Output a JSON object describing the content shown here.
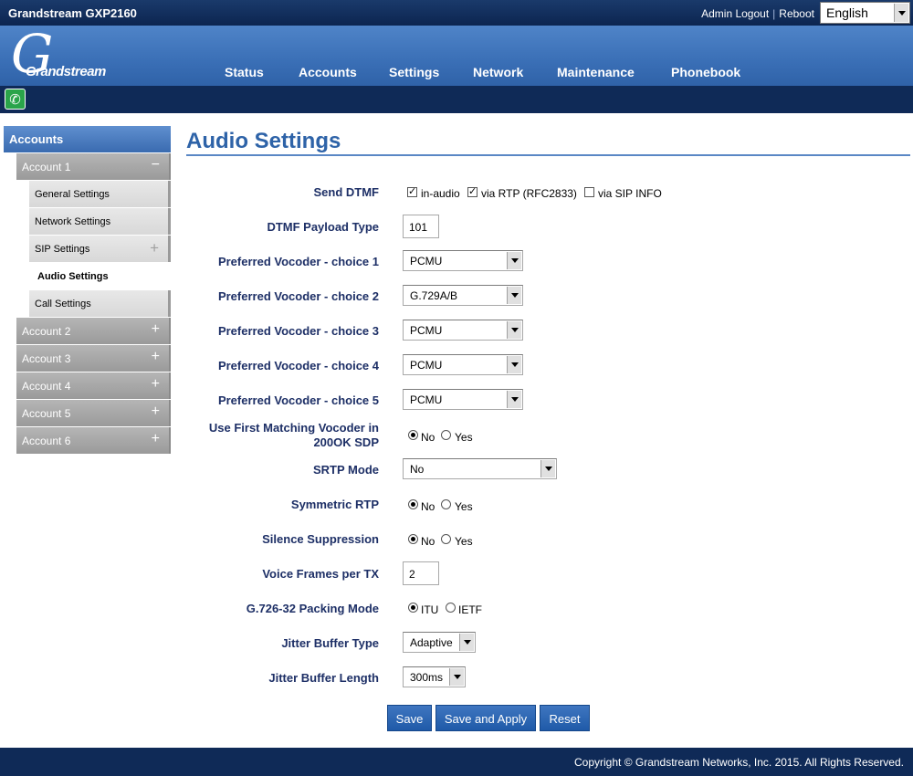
{
  "topbar": {
    "product": "Grandstream GXP2160",
    "admin_logout": "Admin Logout",
    "reboot": "Reboot",
    "language": "English"
  },
  "logo": {
    "text": "Grandstream"
  },
  "nav": [
    "Status",
    "Accounts",
    "Settings",
    "Network",
    "Maintenance",
    "Phonebook"
  ],
  "sidebar": {
    "header": "Accounts",
    "account1": "Account 1",
    "sub_items": [
      "General Settings",
      "Network Settings",
      "SIP Settings",
      "Audio Settings",
      "Call Settings"
    ],
    "accounts": [
      "Account 2",
      "Account 3",
      "Account 4",
      "Account 5",
      "Account 6"
    ],
    "expanded_sign": "−",
    "collapsed_sign": "+"
  },
  "page_title": "Audio Settings",
  "form": {
    "send_dtmf": {
      "label": "Send DTMF",
      "options": [
        {
          "label": "in-audio",
          "checked": true
        },
        {
          "label": "via RTP (RFC2833)",
          "checked": true
        },
        {
          "label": "via SIP INFO",
          "checked": false
        }
      ]
    },
    "dtmf_payload": {
      "label": "DTMF Payload Type",
      "value": "101"
    },
    "vocoders": [
      {
        "label": "Preferred Vocoder - choice 1",
        "value": "PCMU"
      },
      {
        "label": "Preferred Vocoder - choice 2",
        "value": "G.729A/B"
      },
      {
        "label": "Preferred Vocoder - choice 3",
        "value": "PCMU"
      },
      {
        "label": "Preferred Vocoder - choice 4",
        "value": "PCMU"
      },
      {
        "label": "Preferred Vocoder - choice 5",
        "value": "PCMU"
      }
    ],
    "first_matching": {
      "label_line1": "Use First Matching Vocoder in",
      "label_line2": "200OK SDP",
      "no": "No",
      "yes": "Yes",
      "selected": "No"
    },
    "srtp_mode": {
      "label": "SRTP Mode",
      "value": "No"
    },
    "symmetric_rtp": {
      "label": "Symmetric RTP",
      "no": "No",
      "yes": "Yes",
      "selected": "No"
    },
    "silence_suppression": {
      "label": "Silence Suppression",
      "no": "No",
      "yes": "Yes",
      "selected": "No"
    },
    "voice_frames": {
      "label": "Voice Frames per TX",
      "value": "2"
    },
    "g726_packing": {
      "label": "G.726-32 Packing Mode",
      "itu": "ITU",
      "ietf": "IETF",
      "selected": "ITU"
    },
    "jitter_type": {
      "label": "Jitter Buffer Type",
      "value": "Adaptive"
    },
    "jitter_length": {
      "label": "Jitter Buffer Length",
      "value": "300ms"
    }
  },
  "buttons": {
    "save": "Save",
    "save_apply": "Save and Apply",
    "reset": "Reset"
  },
  "footer": "Copyright © Grandstream Networks, Inc. 2015. All Rights Reserved.",
  "colors": {
    "brand_blue": "#2e63a8",
    "label_navy": "#1d2f66",
    "header_dark": "#0f2a57"
  }
}
